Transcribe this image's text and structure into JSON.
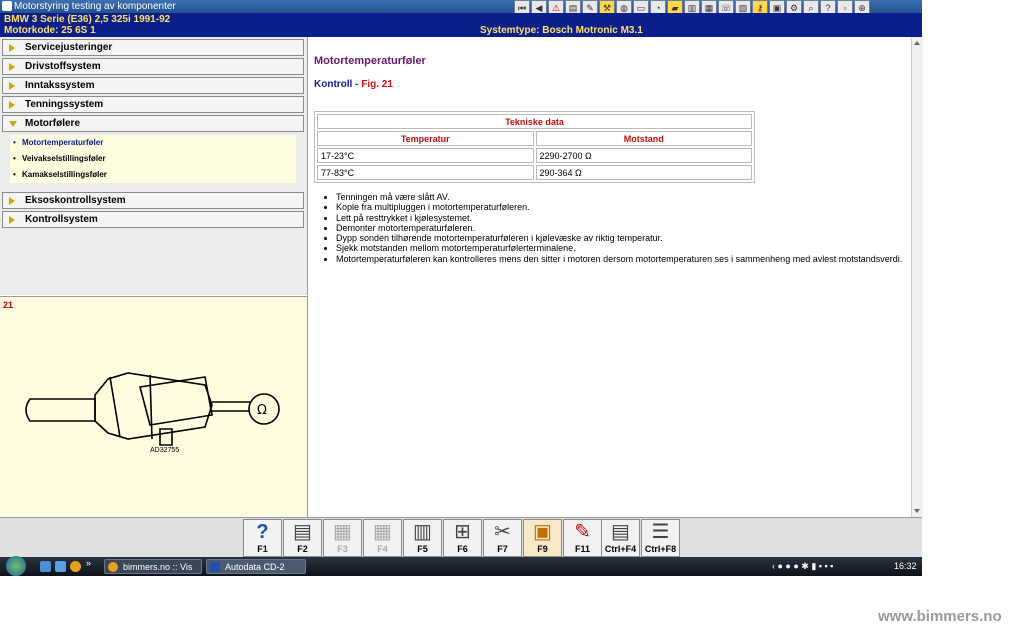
{
  "window": {
    "title": "Motorstyring testing av komponenter",
    "toolbar_icons": [
      "first-page-icon",
      "prev-page-icon",
      "warning-icon",
      "book-icon",
      "tools-icon",
      "wrench-icon",
      "globe-icon",
      "car-icon",
      "gauge-icon",
      "folder-icon",
      "document-icon",
      "chart-icon",
      "phone-icon",
      "printer-icon",
      "key-icon",
      "camera-icon",
      "settings-icon",
      "search-icon",
      "help-icon",
      "exit-icon",
      "zoom-icon"
    ]
  },
  "vehicle": {
    "line1": "BMW    3 Serie (E36) 2,5 325i 1991-92",
    "line2": "Motorkode: 25 6S 1",
    "system": "Systemtype: Bosch Motronic M3.1"
  },
  "sidebar": {
    "items": [
      {
        "label": "Servicejusteringer"
      },
      {
        "label": "Drivstoffsystem"
      },
      {
        "label": "Inntakssystem"
      },
      {
        "label": "Tenningssystem"
      },
      {
        "label": "Motorfølere"
      },
      {
        "label": "Eksoskontrollsystem"
      },
      {
        "label": "Kontrollsystem"
      }
    ],
    "subitems": [
      {
        "label": "Motortemperaturføler"
      },
      {
        "label": "Veivakselstillingsføler"
      },
      {
        "label": "Kamakselstillingsføler"
      }
    ]
  },
  "figure": {
    "number": "21",
    "code": "AD32755"
  },
  "content": {
    "title": "Motortemperaturføler",
    "subtitle_k": "Kontroll",
    "subtitle_sep": " - ",
    "subtitle_f": "Fig. 21",
    "table": {
      "caption": "Tekniske data",
      "headers": [
        "Temperatur",
        "Motstand"
      ],
      "rows": [
        [
          "17-23°C",
          "2290-2700 Ω"
        ],
        [
          "77-83°C",
          "290-364 Ω"
        ]
      ]
    },
    "steps": [
      "Tenningen må være slått AV.",
      "Kople fra multipluggen i motortemperaturføleren.",
      "Lett på resttrykket i kjølesystemet.",
      "Demonter motortemperaturføleren.",
      "Dypp sonden tilhørende motortemperaturføleren i kjølevæske av riktig temperatur.",
      "Sjekk motstanden mellom motortemperaturfølerterminalene.",
      "Motortemperaturføleren kan kontrolleres mens den sitter i motoren dersom motortemperaturen ses i sammenheng med avlest motstandsverdi."
    ]
  },
  "fkeys": {
    "f1": "F1",
    "f2": "F2",
    "f3": "F3",
    "f4": "F4",
    "f5": "F5",
    "f6": "F6",
    "f7": "F7",
    "f9": "F9",
    "f11": "F11",
    "ctrlf4": "Ctrl+F4",
    "ctrlf8": "Ctrl+F8"
  },
  "taskbar": {
    "task1": "bimmers.no :: Vis Te...",
    "task2": "Autodata CD-2",
    "clock": "16:32"
  },
  "watermark": "www.bimmers.no",
  "colors": {
    "header_bg": "#0a1e8c",
    "header_text": "#ffe066",
    "title_purple": "#6a1a6a",
    "accent_red": "#d01010",
    "panel_yellow": "#fffce0"
  }
}
